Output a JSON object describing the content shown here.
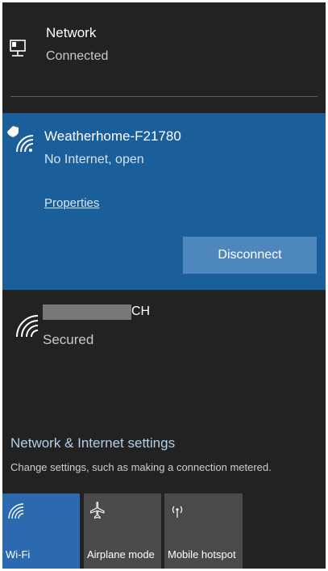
{
  "wired": {
    "name": "Network",
    "status": "Connected",
    "icon": "monitor-network-icon"
  },
  "connected_network": {
    "name": "Weatherhome-F21780",
    "status": "No Internet, open",
    "properties_label": "Properties",
    "disconnect_label": "Disconnect",
    "icon": "wifi-warning-shield-icon",
    "accent": "#1a5e9a"
  },
  "other_network": {
    "name_suffix": "CH",
    "status": "Secured",
    "icon": "wifi-icon"
  },
  "settings": {
    "title": "Network & Internet settings",
    "subtitle": "Change settings, such as making a connection metered."
  },
  "tiles": [
    {
      "label": "Wi-Fi",
      "icon": "wifi-icon",
      "active": true
    },
    {
      "label": "Airplane mode",
      "icon": "airplane-icon",
      "active": false
    },
    {
      "label": "Mobile hotspot",
      "icon": "hotspot-icon",
      "active": false
    }
  ],
  "colors": {
    "panel_bg": "#222222",
    "active_tile": "#2b6aae",
    "link": "#b4cfea"
  }
}
